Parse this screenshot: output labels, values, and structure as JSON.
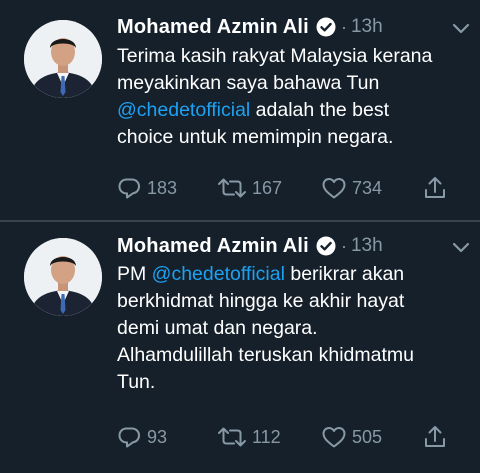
{
  "colors": {
    "background": "#15202b",
    "text": "#ffffff",
    "secondary": "#8899a6",
    "link": "#1da1f2",
    "divider": "#38444d"
  },
  "icons": {
    "verified": "verified-badge-icon",
    "reply": "reply-icon",
    "retweet": "retweet-icon",
    "like": "like-icon",
    "share": "share-icon",
    "more": "chevron-down-icon"
  },
  "tweets": [
    {
      "author": "Mohamed Azmin Ali",
      "separator": "·",
      "time": "13h",
      "lines": [
        [
          {
            "text": "Terima kasih rakyat Malaysia kerana"
          }
        ],
        [
          {
            "text": "meyakinkan saya bahawa Tun"
          }
        ],
        [
          {
            "text": "@chedetofficial",
            "mention": true
          },
          {
            "text": " adalah the best"
          }
        ],
        [
          {
            "text": "choice untuk memimpin negara."
          }
        ]
      ],
      "replies": "183",
      "retweets": "167",
      "likes": "734"
    },
    {
      "author": "Mohamed Azmin Ali",
      "separator": "·",
      "time": "13h",
      "lines": [
        [
          {
            "text": "PM "
          },
          {
            "text": "@chedetofficial",
            "mention": true
          },
          {
            "text": " berikrar akan"
          }
        ],
        [
          {
            "text": "berkhidmat hingga ke akhir hayat"
          }
        ],
        [
          {
            "text": "demi umat dan negara."
          }
        ],
        [
          {
            "text": "Alhamdulillah teruskan khidmatmu"
          }
        ],
        [
          {
            "text": "Tun."
          }
        ]
      ],
      "replies": "93",
      "retweets": "112",
      "likes": "505"
    }
  ]
}
